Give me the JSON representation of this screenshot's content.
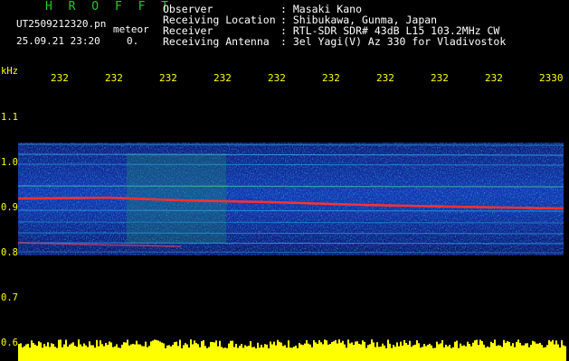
{
  "header": {
    "title": "H R O F F T",
    "filename": "UT2509212320.pn",
    "tag": "meteor",
    "datetime": "25.09.21 23:20",
    "count": "0.",
    "info": [
      {
        "label": "Observer",
        "value": ": Masaki Kano"
      },
      {
        "label": "Receiving Location",
        "value": ": Shibukawa, Gunma, Japan"
      },
      {
        "label": "Receiver",
        "value": ": RTL-SDR SDR# 43dB L15 103.2MHz CW"
      },
      {
        "label": "Receiving Antenna",
        "value": ": 3el Yagi(V) Az 330 for Vladivostok"
      }
    ]
  },
  "axis": {
    "unit": "kHz",
    "x_ticks": [
      "232",
      "232",
      "232",
      "232",
      "232",
      "232",
      "232",
      "232",
      "232",
      "2330"
    ],
    "y_ticks": [
      "1.1",
      "1.0",
      "0.9",
      "0.8",
      "0.7",
      "0.6"
    ]
  },
  "colors": {
    "header_title": "#22cc22",
    "text": "#ffffff",
    "axis": "#ffff00",
    "band": "#0a2a8a",
    "carrier": "#ff3030",
    "noise": "#ffff00"
  }
}
